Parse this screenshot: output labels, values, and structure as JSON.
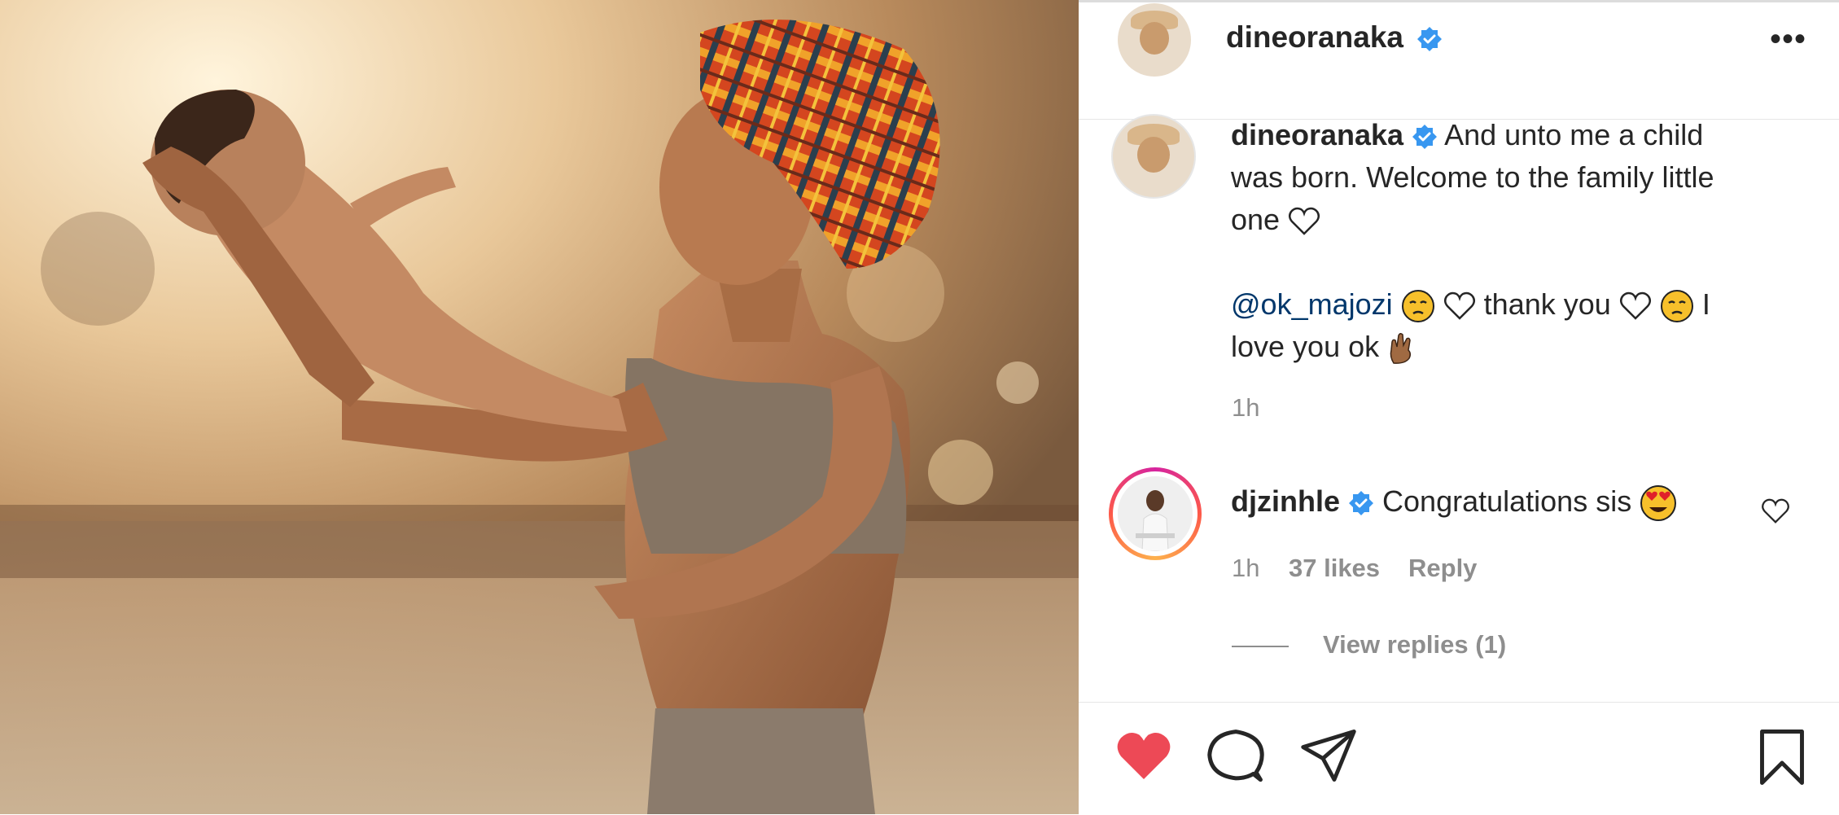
{
  "post": {
    "author": "dineoranaka",
    "more_label": "•••",
    "caption_line1": "And unto me a child",
    "caption_line2": "was born. Welcome to the family little",
    "caption_line3": "one",
    "mention": "@ok_majozi",
    "thanks_text": "thank you",
    "love_text_1": "I",
    "love_text_2": "love you ok",
    "caption_time": "1h"
  },
  "comment": {
    "author": "djzinhle",
    "text": "Congratulations sis",
    "time": "1h",
    "likes": "37 likes",
    "reply_label": "Reply",
    "view_replies": "View replies (1)"
  },
  "colors": {
    "like_red": "#ed4956",
    "verified_blue": "#3897f0",
    "mention_blue": "#00376b",
    "meta_gray": "#8e8e8e"
  },
  "icons": {
    "verified": "verified-badge-icon",
    "heart_outline": "heart-outline-icon",
    "like": "like-heart-icon",
    "comment": "comment-bubble-icon",
    "share": "share-plane-icon",
    "save": "bookmark-icon"
  }
}
